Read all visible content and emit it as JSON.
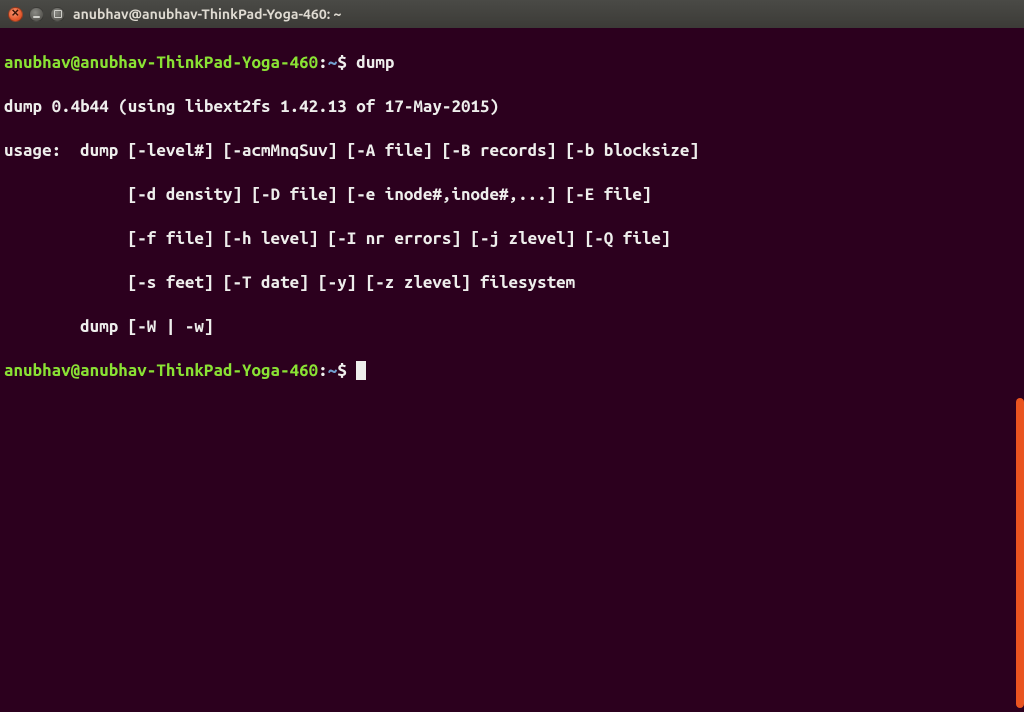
{
  "window": {
    "title": "anubhav@anubhav-ThinkPad-Yoga-460: ~"
  },
  "prompt": {
    "userhost": "anubhav@anubhav-ThinkPad-Yoga-460",
    "colon": ":",
    "path": "~",
    "dollar": "$"
  },
  "command1": "dump",
  "output": {
    "l1": "dump 0.4b44 (using libext2fs 1.42.13 of 17-May-2015)",
    "l2": "usage:  dump [-level#] [-acmMnqSuv] [-A file] [-B records] [-b blocksize]",
    "l3": "             [-d density] [-D file] [-e inode#,inode#,...] [-E file]",
    "l4": "             [-f file] [-h level] [-I nr errors] [-j zlevel] [-Q file]",
    "l5": "             [-s feet] [-T date] [-y] [-z zlevel] filesystem",
    "l6": "        dump [-W | -w]"
  },
  "colors": {
    "bg": "#2c001e",
    "fg": "#eeeeec",
    "prompt_user": "#8ae234",
    "prompt_path": "#729fcf",
    "scrollbar": "#e95420"
  }
}
